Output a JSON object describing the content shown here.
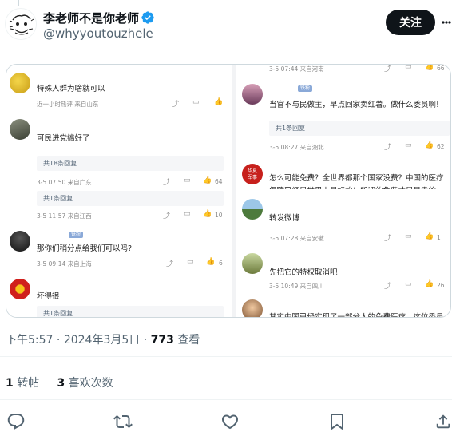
{
  "author": {
    "name": "李老师不是你老师",
    "handle": "@whyyoutouzhele",
    "follow_label": "关注"
  },
  "media": {
    "left_comments": [
      {
        "text": "特殊人群为啥就可以",
        "meta": "近一小时热评 来自山东",
        "likes": ""
      },
      {
        "text": "可民进党搞好了",
        "reply": "共18条回复",
        "meta": "3-5 07:50 来自广东",
        "likes": "64"
      },
      {
        "reply": "共1条回复",
        "meta": "3-5 11:57 来自江西",
        "likes": "10"
      },
      {
        "text": "那你们稍分点给我们可以吗?",
        "meta": "3-5 09:14 来自上海",
        "likes": "6"
      },
      {
        "text": "坏得很",
        "reply": "共1条回复"
      }
    ],
    "right_comments": [
      {
        "meta": "3-5 07:44 来自河南",
        "likes": "66"
      },
      {
        "text": "当官不与民做主，早点回家卖红薯。做什么委员啊!",
        "reply": "共1条回复",
        "meta": "3-5 08:27 来自湖北",
        "likes": "62"
      },
      {
        "text": "怎么可能免费？全世界都那个国家没费？中国的医疗",
        "text2": "保障已经是世界上最好的！所谓的免费才是最贵的",
        "avatar_text": "华夏\n军事"
      },
      {
        "text": "转发微博",
        "meta": "3-5 07:28 来自安徽",
        "likes": "1"
      },
      {
        "text": "先把它的特权取消吧",
        "meta": "3-5 10:49 来自四川",
        "likes": "26"
      },
      {
        "text": "其实中国已经实现了一部分人的免费医疗，这位委员"
      }
    ],
    "tag_label": "铁粉"
  },
  "timestamp": {
    "time": "下午5:57",
    "date": "2024年3月5日",
    "views": "773",
    "views_label": "查看"
  },
  "stats": {
    "reposts": "1",
    "reposts_label": "转帖",
    "likes": "3",
    "likes_label": "喜欢次数"
  },
  "icons": {
    "reply": "reply-icon",
    "repost": "repost-icon",
    "like": "heart-icon",
    "bookmark": "bookmark-icon",
    "share": "share-icon"
  },
  "colors": {
    "follow_bg": "#0f1419",
    "verified": "#1d9bf0",
    "secondary_text": "#536471"
  }
}
